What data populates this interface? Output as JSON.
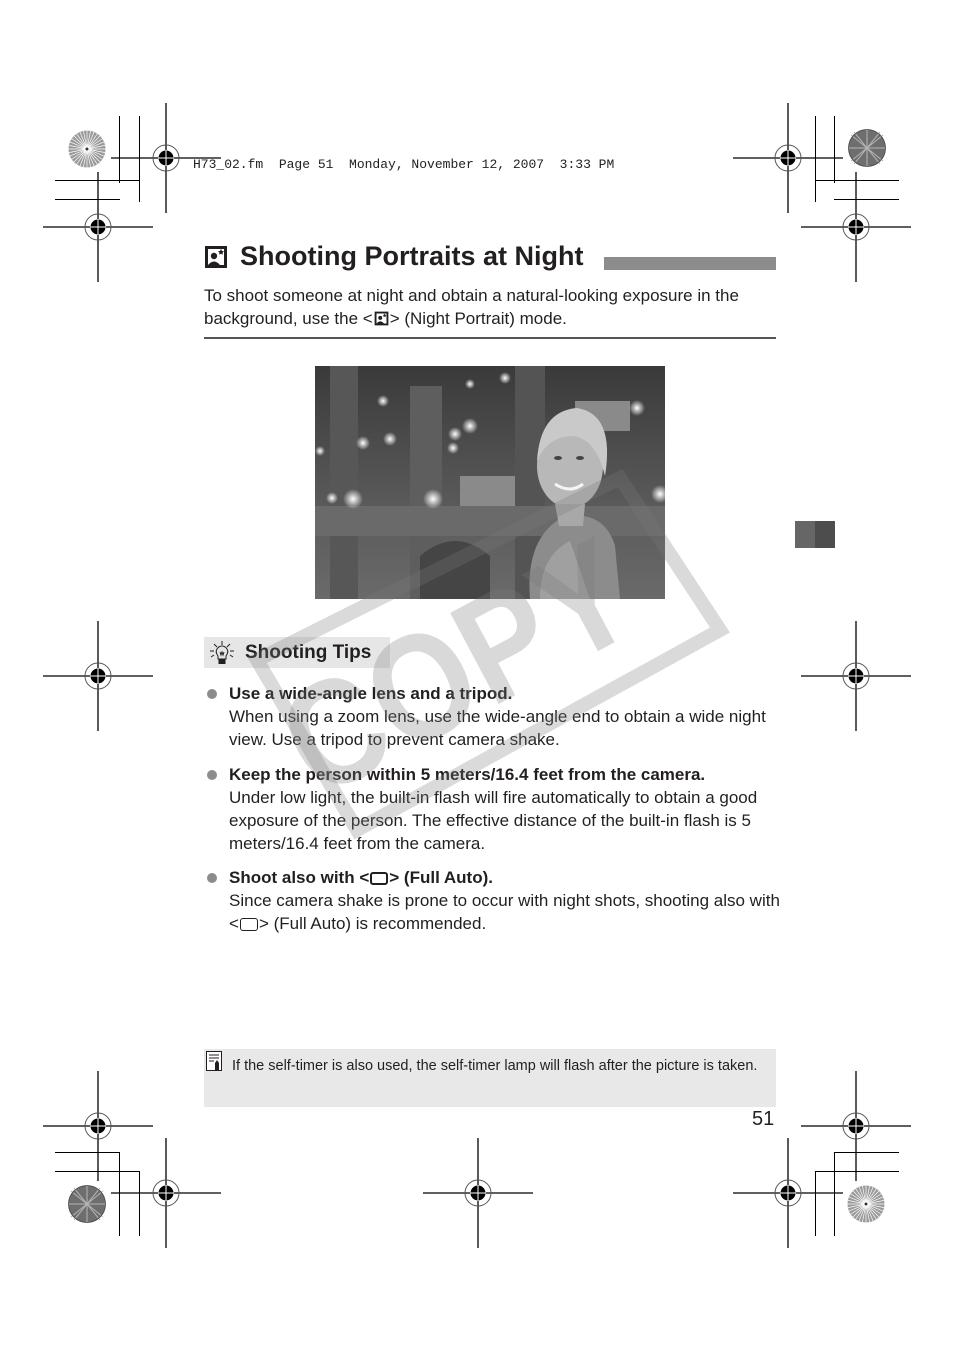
{
  "slug": {
    "text": "H73_02.fm  Page 51  Monday, November 12, 2007  3:33 PM"
  },
  "header": {
    "icon": "night-portrait-icon",
    "title": "Shooting Portraits at Night"
  },
  "intro": {
    "part1": "To shoot someone at night and obtain a natural-looking exposure in the background, use the <",
    "icon": "night-portrait-icon",
    "part2": "> (Night Portrait) mode."
  },
  "photo": {
    "description": "Woman smiling at night with blurred lights in background"
  },
  "tips": {
    "icon": "lightbulb-icon",
    "heading": "Shooting Tips",
    "items": [
      {
        "head": "Use a wide-angle lens and a tripod.",
        "body": "When using a zoom lens, use the wide-angle end to obtain a wide night view. Use a tripod to prevent camera shake."
      },
      {
        "head": "Keep the person within 5 meters/16.4 feet from the camera.",
        "body": "Under low light, the built-in flash will fire automatically to obtain a good exposure of the person. The effective distance of the built-in flash is 5 meters/16.4 feet from the camera."
      },
      {
        "head_part1": "Shoot also with <",
        "head_icon": "full-auto-icon",
        "head_part2": "> (Full Auto).",
        "body_part1": "Since camera shake is prone to occur with night shots, shooting also with <",
        "body_icon": "full-auto-icon",
        "body_part2": "> (Full Auto) is recommended."
      }
    ]
  },
  "note": {
    "icon": "memo-icon",
    "text": "If the self-timer is also used, the self-timer lamp will flash after the picture is taken."
  },
  "page_number": "51",
  "watermark": {
    "text": "COPY"
  },
  "colors": {
    "text": "#231f20",
    "title_bar": "#8c8c8c",
    "tips_bg": "#e6e6e6",
    "note_bg": "#e8e8e8",
    "bullet": "#8c8c8c",
    "tab_marker": [
      "#666666",
      "#4d4d4d"
    ]
  }
}
